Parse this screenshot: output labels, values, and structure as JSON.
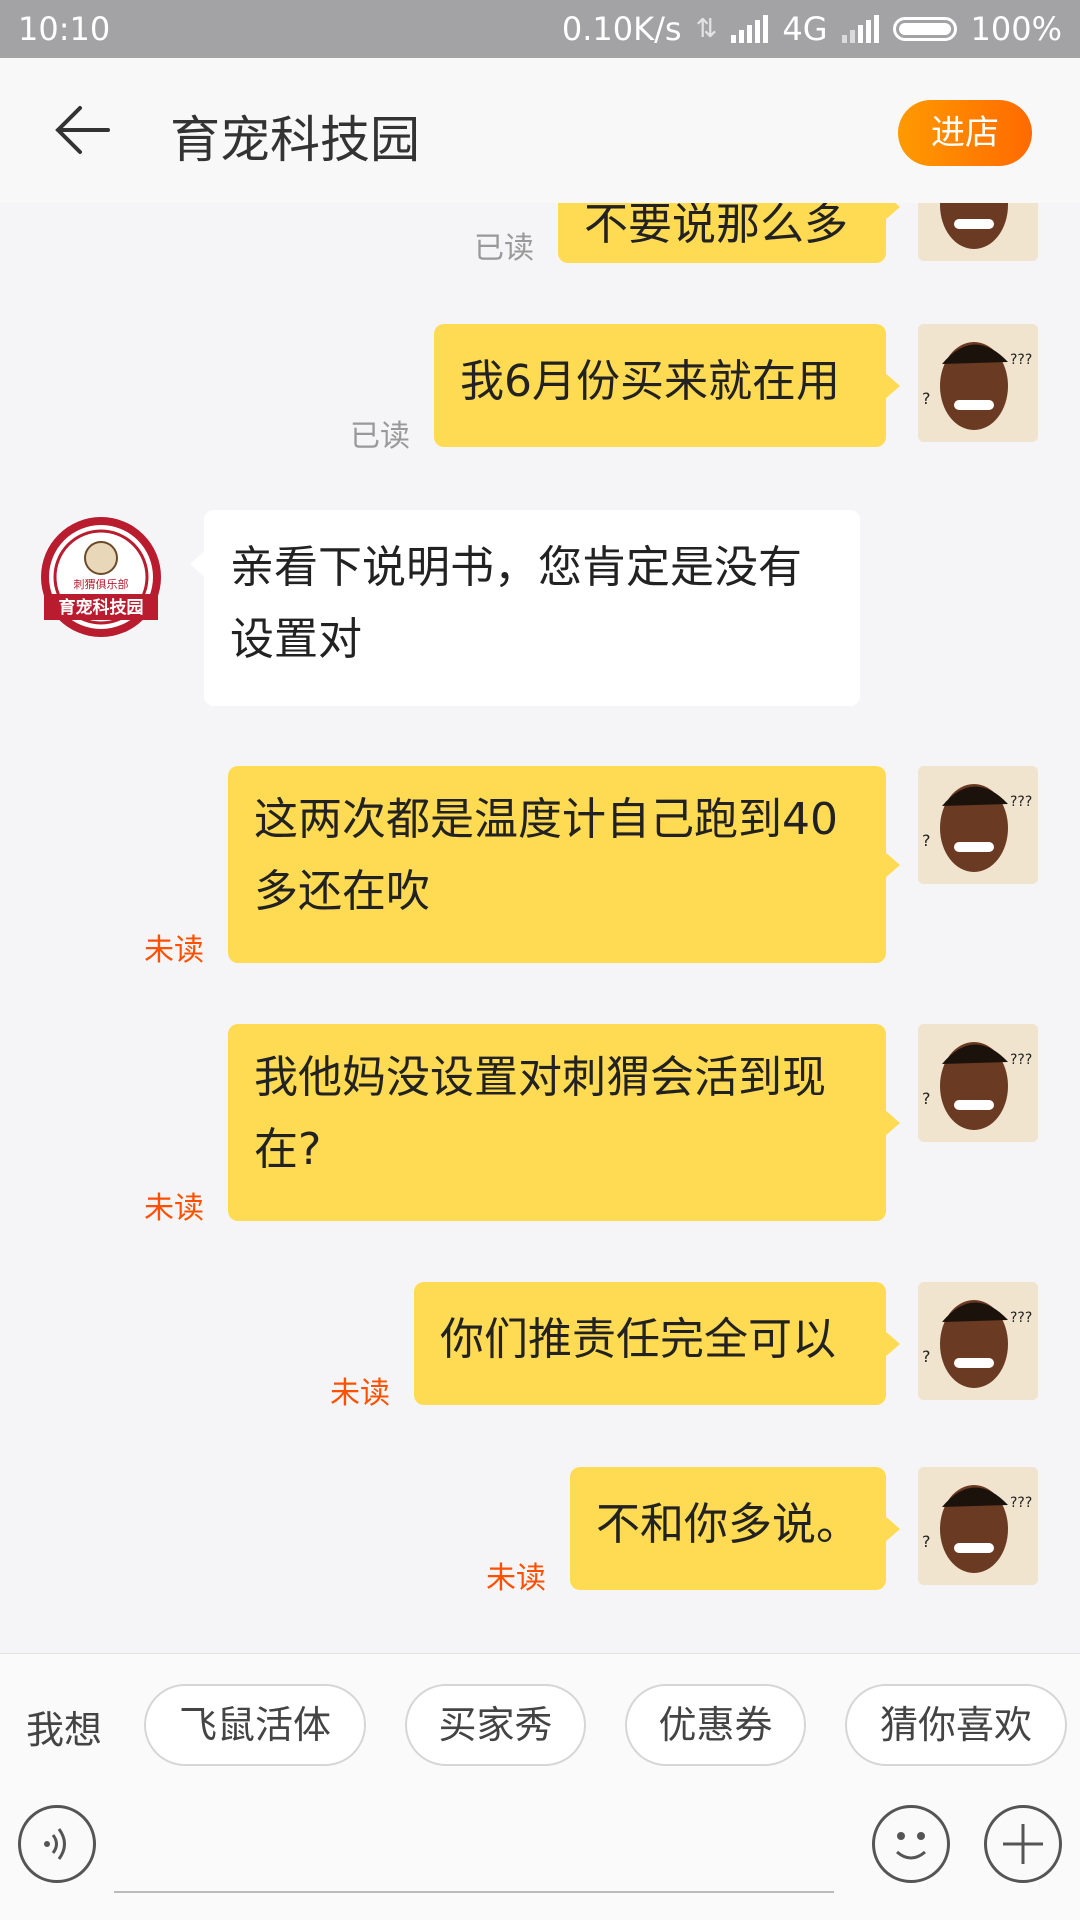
{
  "status_bar": {
    "time": "10:10",
    "net_speed": "0.10K/s",
    "network": "4G",
    "battery": "100%"
  },
  "header": {
    "title": "育宠科技园",
    "enter_store": "进店"
  },
  "messages": [
    {
      "from": "me",
      "text": "不要说那么多",
      "status": "已读"
    },
    {
      "from": "me",
      "text": "我6月份买来就在用",
      "status": "已读"
    },
    {
      "from": "shop",
      "text": "亲看下说明书，您肯定是没有设置对"
    },
    {
      "from": "me",
      "text": "这两次都是温度计自己跑到40多还在吹",
      "status": "未读"
    },
    {
      "from": "me",
      "text": "我他妈没设置对刺猬会活到现在?",
      "status": "未读"
    },
    {
      "from": "me",
      "text": "你们推责任完全可以",
      "status": "未读"
    },
    {
      "from": "me",
      "text": "不和你多说。",
      "status": "未读"
    }
  ],
  "shop_avatar": {
    "top_text": "刺猬俱乐部",
    "bottom_text": "育宠科技园"
  },
  "suggestions": {
    "label": "我想",
    "chips": [
      "飞鼠活体",
      "买家秀",
      "优惠券",
      "猜你喜欢"
    ]
  },
  "colors": {
    "my_bubble": "#fedb52",
    "unread": "#ff5000",
    "accent": "#ff7a00"
  },
  "icons": {
    "back": "arrow-left-icon",
    "voice": "voice-icon",
    "emoji": "smiley-icon",
    "more": "plus-icon"
  }
}
